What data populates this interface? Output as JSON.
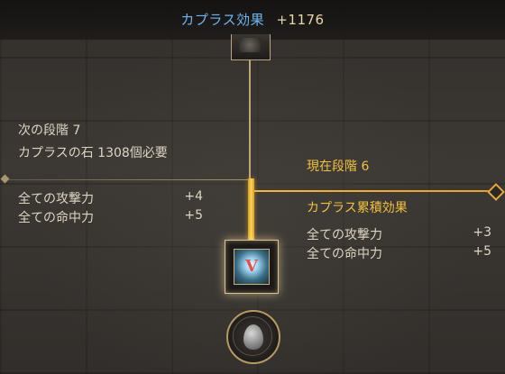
{
  "header": {
    "label": "カプラス効果",
    "value": "+1176"
  },
  "next_stage": {
    "title": "次の段階 7",
    "requirement": "カプラスの石 1308個必要",
    "stats": [
      {
        "name": "全ての攻撃力",
        "value": "+4"
      },
      {
        "name": "全ての命中力",
        "value": "+5"
      }
    ]
  },
  "current_stage": {
    "title": "現在段階 6",
    "accumulated_title": "カプラス累積効果",
    "stats": [
      {
        "name": "全ての攻撃力",
        "value": "+3"
      },
      {
        "name": "全ての命中力",
        "value": "+5"
      }
    ]
  },
  "skill_node": {
    "glyph": "V"
  },
  "colors": {
    "header_label": "#6fb5f0",
    "highlight": "#f0c040",
    "line_gold": "#f1b63a"
  },
  "icons": [
    "node-icon",
    "skill-icon",
    "kaplas-stone-icon"
  ]
}
